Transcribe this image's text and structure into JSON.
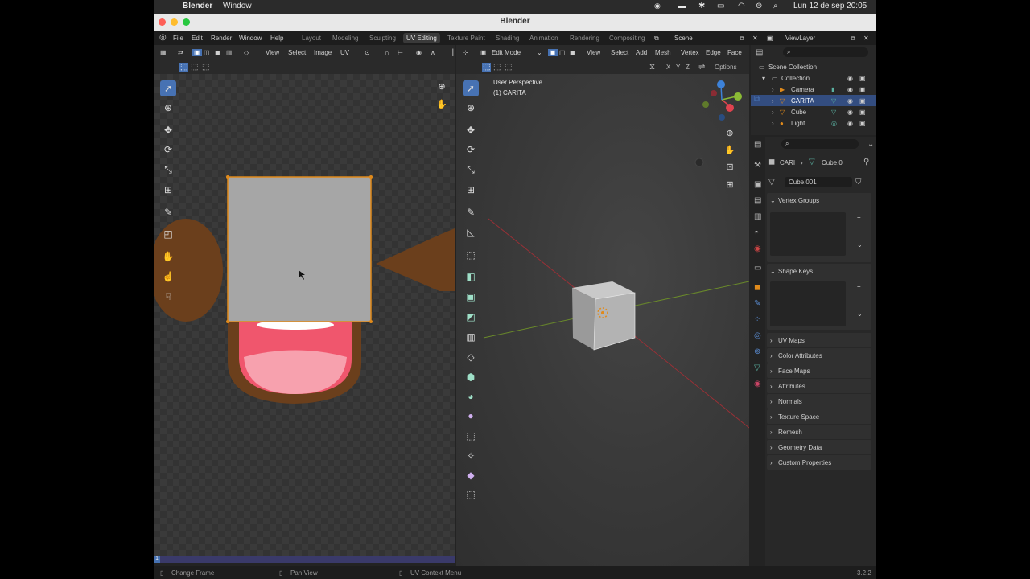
{
  "macos_menubar": {
    "app": "Blender",
    "window": "Window",
    "datetime": "Lun 12 de sep  20:05"
  },
  "window_title": "Blender",
  "topbar": {
    "menus": [
      "File",
      "Edit",
      "Render",
      "Window",
      "Help"
    ],
    "workspaces": [
      "Layout",
      "Modeling",
      "Sculpting",
      "UV Editing",
      "Texture Paint",
      "Shading",
      "Animation",
      "Rendering",
      "Compositing"
    ],
    "active_workspace": "UV Editing",
    "scene": "Scene",
    "view_layer": "ViewLayer"
  },
  "uv_editor": {
    "menus": [
      "View",
      "Select",
      "Image",
      "UV"
    ]
  },
  "viewport": {
    "mode": "Edit Mode",
    "menus": [
      "View",
      "Select",
      "Add",
      "Mesh",
      "Vertex",
      "Edge",
      "Face"
    ],
    "axes": [
      "X",
      "Y",
      "Z"
    ],
    "options": "Options",
    "overlay_title": "User Perspective",
    "overlay_object": "(1) CARITA",
    "gizmo_colors": {
      "x": "#e0434f",
      "y": "#8bbb35",
      "z": "#3d82d9"
    }
  },
  "outliner": {
    "root": "Scene Collection",
    "collection": "Collection",
    "items": [
      {
        "name": "Camera",
        "icon": "camera-icon",
        "selected": false
      },
      {
        "name": "CARITA",
        "icon": "mesh-icon",
        "selected": true
      },
      {
        "name": "Cube",
        "icon": "mesh-icon",
        "selected": false
      },
      {
        "name": "Light",
        "icon": "light-icon",
        "selected": false
      }
    ]
  },
  "properties": {
    "breadcrumb_object": "CARI",
    "breadcrumb_mesh": "Cube.0",
    "mesh_name": "Cube.001",
    "vertex_groups": "Vertex Groups",
    "shape_keys": "Shape Keys",
    "panels": [
      "UV Maps",
      "Color Attributes",
      "Face Maps",
      "Attributes",
      "Normals",
      "Texture Space",
      "Remesh",
      "Geometry Data",
      "Custom Properties"
    ]
  },
  "statusbar": {
    "hint1": "Change Frame",
    "hint2": "Pan View",
    "hint3": "UV Context Menu",
    "version": "3.2.2"
  },
  "frame_badge": "1",
  "colors": {
    "accent": "#4772b3",
    "uv_square": "#a6a6a6",
    "uv_border": "#e08a1b",
    "texture_brown": "#6b3f1c",
    "mouth_red": "#f0566d",
    "mouth_pink": "#f7a1ae"
  }
}
